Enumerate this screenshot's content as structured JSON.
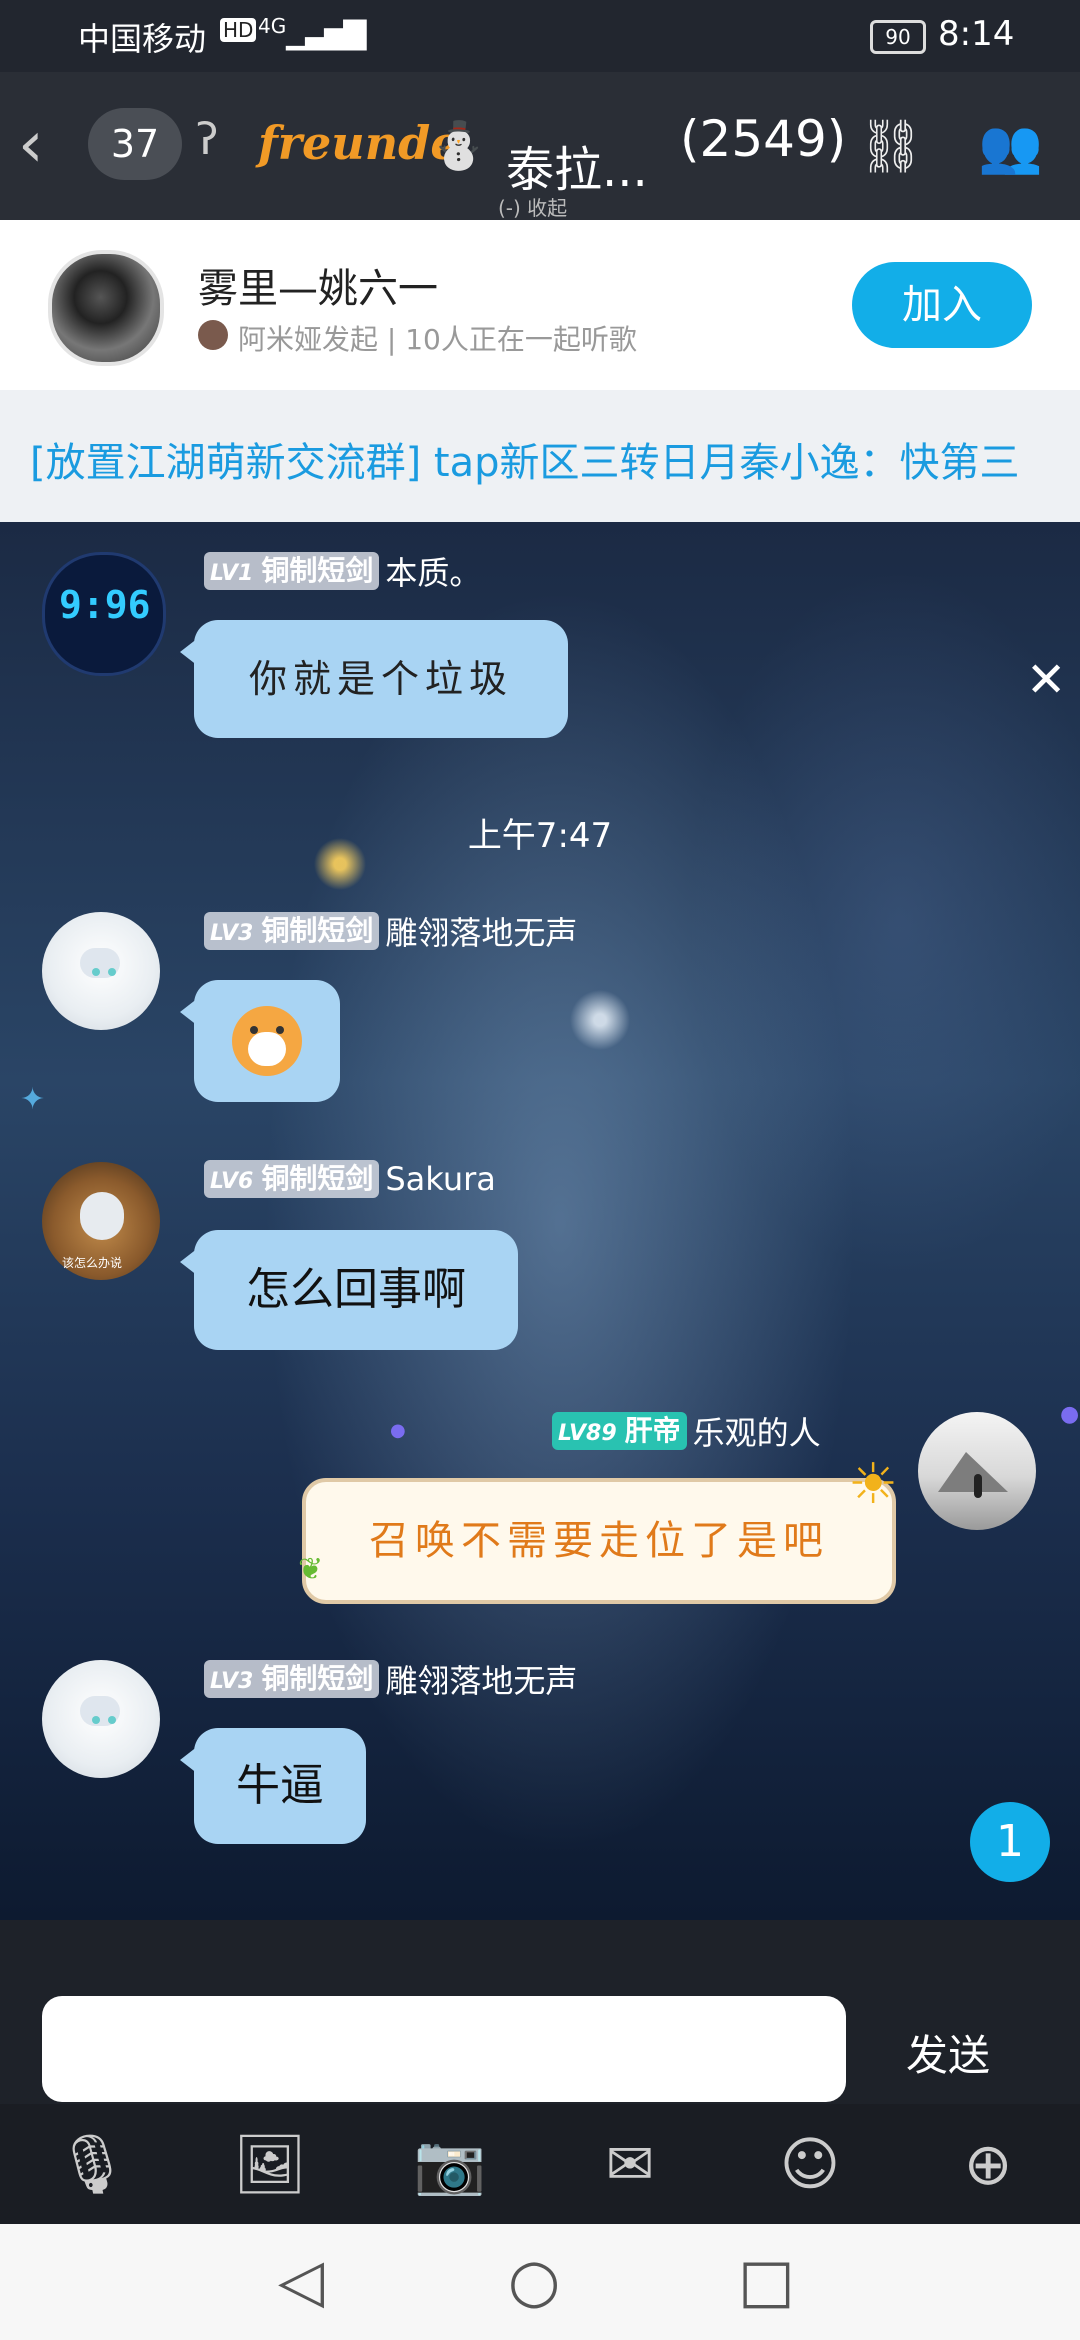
{
  "status_bar": {
    "carrier": "中国移动",
    "hd": "HD",
    "network": "4G",
    "battery": "90",
    "time": "8:14"
  },
  "header": {
    "back_icon": "chevron-left-icon",
    "unread_count": "37",
    "ear_icon": "ear-icon",
    "logo_text": "freunde",
    "chat_title": "泰拉...",
    "sub_label": "(-) 收起",
    "member_count": "(2549)",
    "share_icon": "share-link-icon",
    "members_icon": "members-icon"
  },
  "music": {
    "song_title": "雾里—姚六一",
    "subtitle": "阿米娅发起 | 10人正在一起听歌",
    "join_label": "加入"
  },
  "announcement": {
    "text": "[放置江湖萌新交流群] tap新区三转日月秦小逸：快第三"
  },
  "messages": [
    {
      "level": "LV1",
      "badge": "铜制短剑",
      "name": "本质。",
      "text": "你就是个垃圾"
    },
    {
      "timestamp": "上午7:47"
    },
    {
      "level": "LV3",
      "badge": "铜制短剑",
      "name": "雕翎落地无声",
      "sticker": "shiba-sticker"
    },
    {
      "level": "LV6",
      "badge": "铜制短剑",
      "name": "Sakura",
      "text": "怎么回事啊",
      "avatar_caption": "该怎么办说"
    },
    {
      "level": "LV89",
      "badge": "肝帝",
      "name": "乐观的人",
      "text": "召唤不需要走位了是吧"
    },
    {
      "level": "LV3",
      "badge": "铜制短剑",
      "name": "雕翎落地无声",
      "text": "牛逼"
    }
  ],
  "clock_avatar_text": "9:96",
  "unread_badge": "1",
  "input": {
    "placeholder": "",
    "send_label": "发送"
  },
  "toolbar": [
    "microphone-icon",
    "image-icon",
    "camera-icon",
    "red-packet-icon",
    "emoji-icon",
    "plus-icon"
  ],
  "colors": {
    "accent": "#12aee8",
    "bubble": "#a9d4f3",
    "announcement": "#1a9be0"
  }
}
